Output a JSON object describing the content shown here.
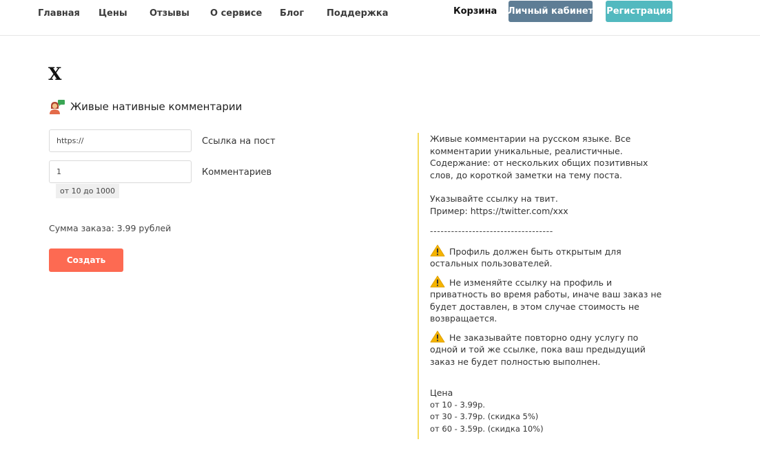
{
  "nav": {
    "items": [
      "Главная",
      "Цены",
      "Отзывы",
      "О сервисе",
      "Блог",
      "Поддержка"
    ],
    "cart": "Корзина",
    "cabinet_button": "Личный кабинет",
    "register_button": "Регистрация"
  },
  "page": {
    "title": "X",
    "service_title": "Живые нативные комментарии"
  },
  "form": {
    "url_value": "https://",
    "url_label": "Ссылка на пост",
    "count_value": "1",
    "count_label": "Комментариев",
    "count_hint": "от 10 до 1000",
    "total": "Сумма заказа: 3.99 рублей",
    "submit": "Создать"
  },
  "info": {
    "description": "Живые комментарии на русском языке. Все комментарии уникальные, реалистичные. Содержание: от нескольких общих позитивных слов, до короткой заметки на тему поста.",
    "instruction_line1": "Указывайте ссылку на твит.",
    "instruction_line2": "Пример: https://twitter.com/xxx",
    "separator": "-----------------------------------",
    "warnings": [
      "Профиль должен быть открытым для остальных пользователей.",
      "Не изменяйте ссылку на профиль и приватность во время работы, иначе ваш заказ не будет доставлен, в этом случае стоимость не возвращается.",
      "Не заказывайте повторно одну услугу по одной и той же ссылке, пока ваш предыдущий заказ не будет полностью выполнен."
    ],
    "price_title": "Цена",
    "prices": [
      "от 10 - 3.99р.",
      "от 30 - 3.79р. (скидка 5%)",
      "от 60 - 3.59р. (скидка 10%)"
    ]
  },
  "colors": {
    "cabinet": "#5e7d95",
    "register": "#52b9bf",
    "create": "#fd6a52",
    "info_border": "#f7dc5a",
    "warning_icon": "#f5b400"
  },
  "icons": {
    "service": "person-speech-bubble-icon",
    "warning": "warning-icon"
  }
}
